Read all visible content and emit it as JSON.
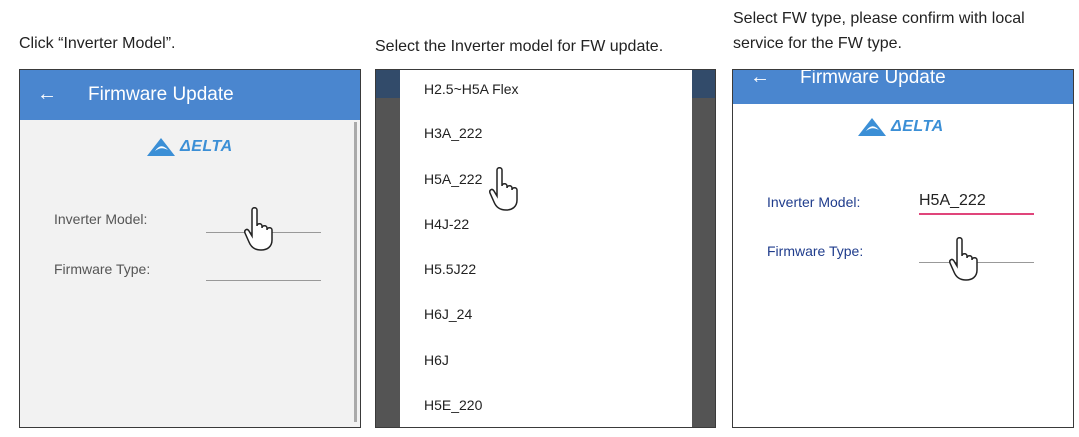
{
  "captions": {
    "step1": "Click “Inverter Model”.",
    "step2": "Select the Inverter model for FW update.",
    "step3": "Select FW type, please confirm with local\nservice for the FW type."
  },
  "screen1": {
    "back_icon": "←",
    "title": "Firmware Update",
    "logo_text": "ΔELTA",
    "inverter_model_label": "Inverter Model:",
    "firmware_type_label": "Firmware Type:"
  },
  "screen2": {
    "models": [
      "H2.5~H5A Flex",
      "H3A_222",
      "H5A_222",
      "H4J-22",
      "H5.5J22",
      "H6J_24",
      "H6J",
      "H5E_220"
    ]
  },
  "screen3": {
    "back_icon": "←",
    "title": "Firmware Update",
    "logo_text": "ΔELTA",
    "inverter_model_label": "Inverter Model:",
    "inverter_model_value": "H5A_222",
    "firmware_type_label": "Firmware Type:"
  },
  "colors": {
    "app_bar": "#4a86cf",
    "brand": "#3b8fd6",
    "label_blue": "#1f3c8c",
    "active_underline": "#e0457b"
  },
  "icons": [
    "back-arrow-icon",
    "delta-logo-icon",
    "pointing-hand-icon"
  ]
}
